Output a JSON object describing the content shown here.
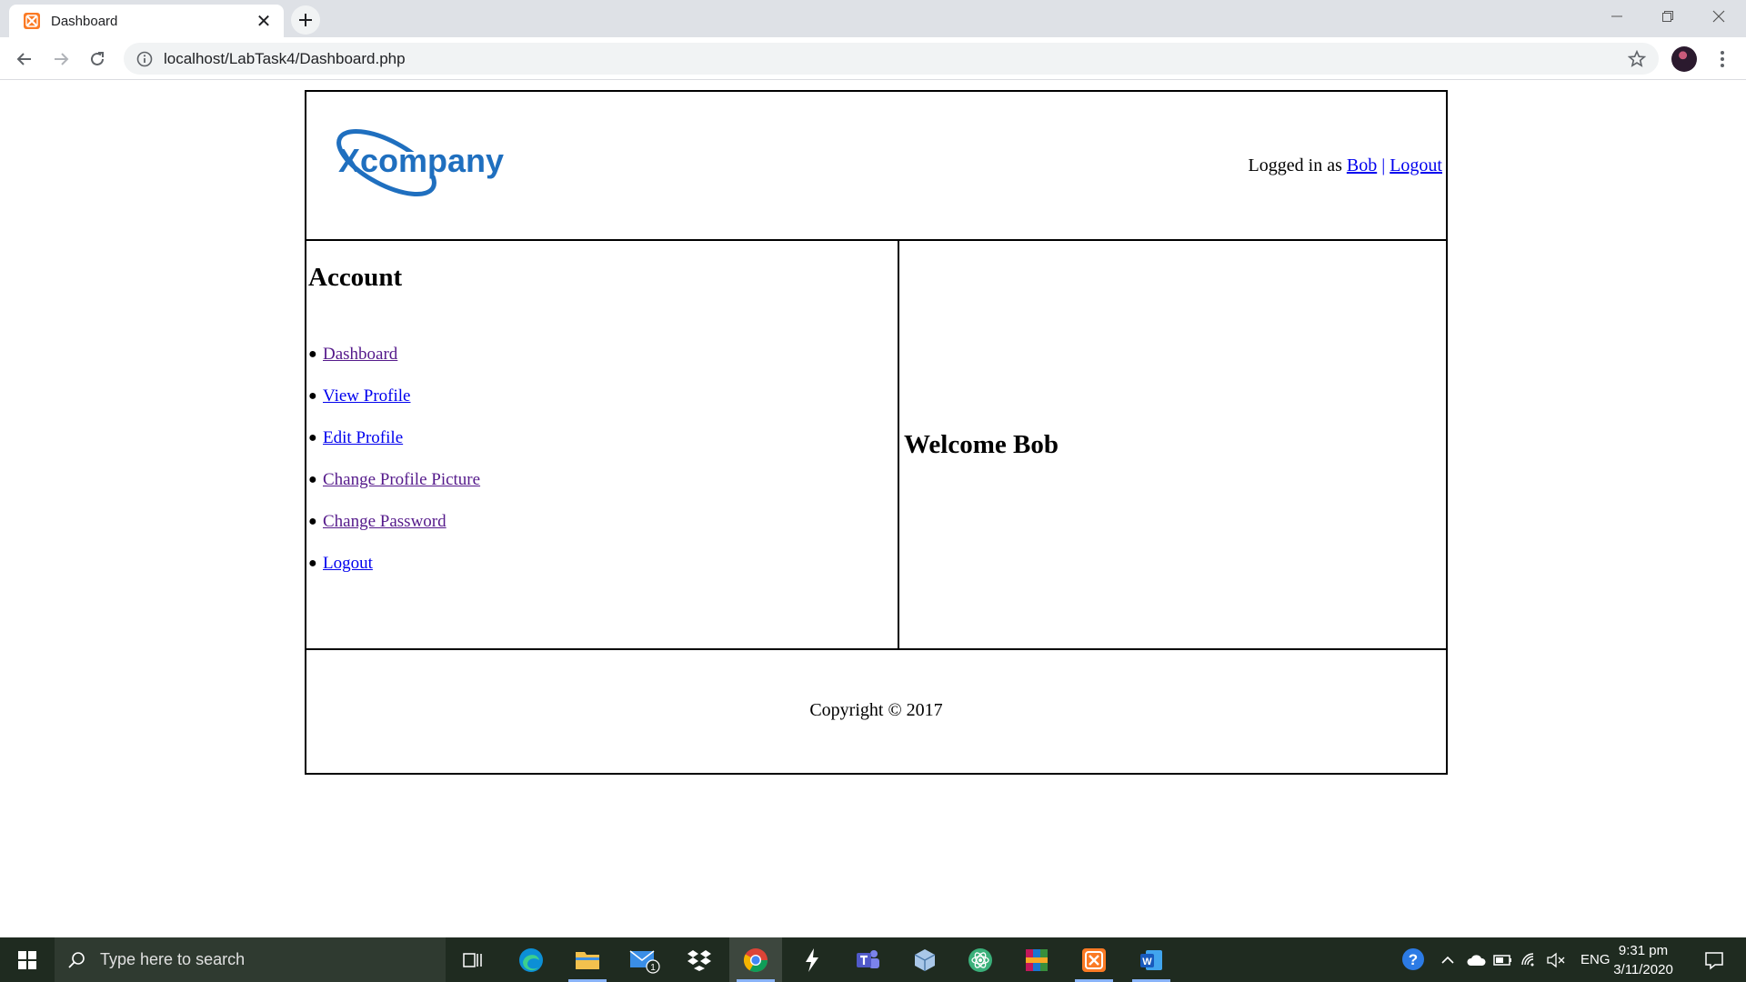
{
  "browser": {
    "tab_title": "Dashboard",
    "url": "localhost/LabTask4/Dashboard.php"
  },
  "header": {
    "logo_text": "Xcompany",
    "logged_in_prefix": "Logged in as",
    "user_link": "Bob",
    "separator": "|",
    "logout_link": "Logout"
  },
  "sidebar": {
    "heading": "Account",
    "items": [
      {
        "label": "Dashboard",
        "visited": true
      },
      {
        "label": "View Profile",
        "visited": false
      },
      {
        "label": "Edit Profile",
        "visited": false
      },
      {
        "label": "Change Profile Picture",
        "visited": true
      },
      {
        "label": "Change Password",
        "visited": true
      },
      {
        "label": "Logout",
        "visited": false
      }
    ],
    "bullet": "●"
  },
  "main": {
    "welcome": "Welcome Bob"
  },
  "footer": {
    "copyright": "Copyright © 2017"
  },
  "taskbar": {
    "search_placeholder": "Type here to search",
    "apps": [
      "task-view",
      "edge",
      "file-explorer",
      "mail",
      "dropbox",
      "chrome",
      "sublime",
      "teams",
      "virtualbox",
      "atom",
      "winrar",
      "xampp",
      "word"
    ],
    "mail_badge": "1",
    "language": "ENG",
    "time": "9:31 pm",
    "date": "3/11/2020"
  },
  "colors": {
    "link": "#0000ee",
    "visited_link": "#551a8b",
    "logo_blue": "#1f6fbf",
    "taskbar": "#1f2b20"
  }
}
